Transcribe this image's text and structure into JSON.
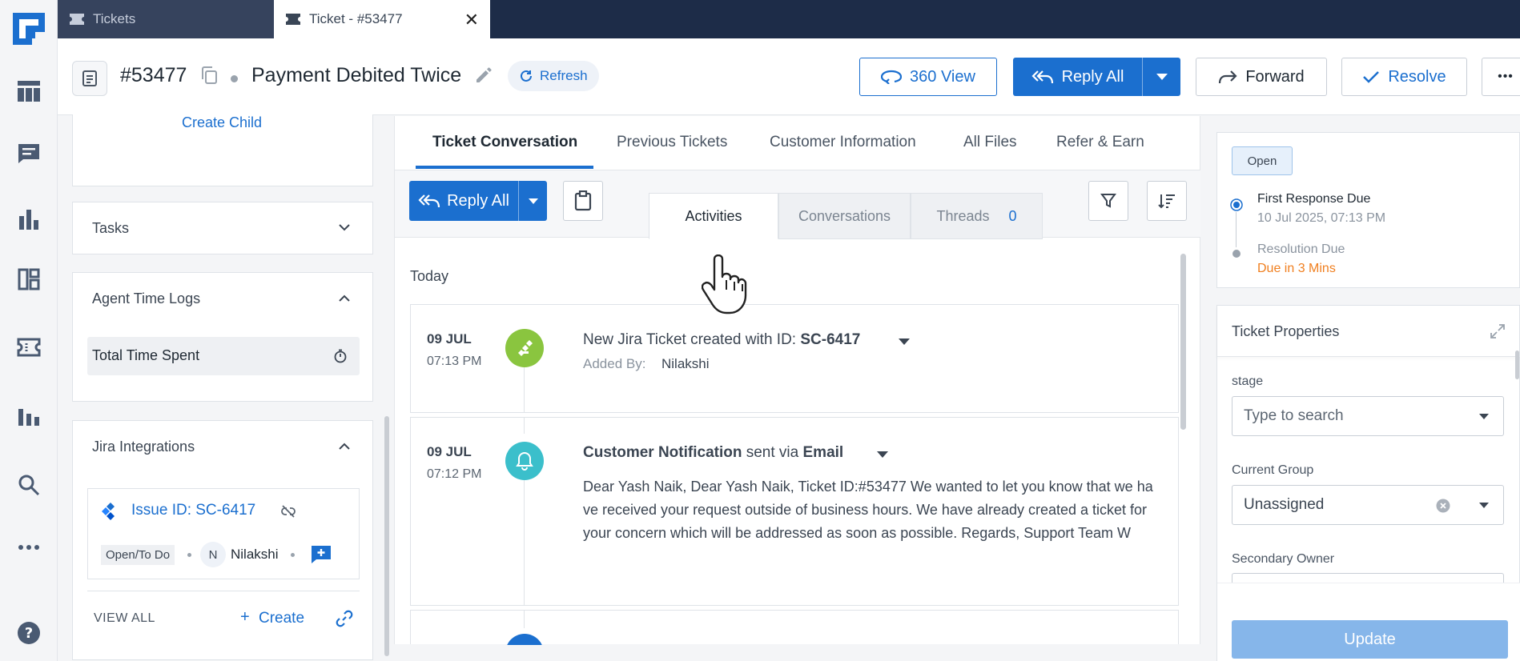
{
  "tabs": [
    {
      "label": "Tickets"
    },
    {
      "label": "Ticket - #53477"
    }
  ],
  "header": {
    "ticket_id": "#53477",
    "title": "Payment Debited Twice",
    "refresh_label": "Refresh",
    "view360_label": "360 View",
    "reply_all_label": "Reply All",
    "forward_label": "Forward",
    "resolve_label": "Resolve",
    "more_label": "•••"
  },
  "left": {
    "create_child": "Create Child",
    "tasks_title": "Tasks",
    "time_logs_title": "Agent Time Logs",
    "total_time_label": "Total Time Spent",
    "jira_title": "Jira Integrations",
    "jira_issue": "Issue ID: SC-6417",
    "jira_status": "Open/To Do",
    "jira_avatar": "N",
    "jira_assignee": "Nilakshi",
    "view_all": "VIEW ALL",
    "create_label": "Create",
    "create_plus": "+"
  },
  "center": {
    "tabs": [
      "Ticket Conversation",
      "Previous Tickets",
      "Customer Information",
      "All Files",
      "Refer & Earn"
    ],
    "reply_all_label": "Reply All",
    "subtabs": [
      "Activities",
      "Conversations",
      "Threads"
    ],
    "threads_count": "0",
    "today_label": "Today",
    "activities": [
      {
        "date": "09 JUL",
        "time": "07:13 PM",
        "text": "New Jira Ticket created with ID: ",
        "bold": "SC-6417",
        "added_by_label": "Added By:",
        "added_by": "Nilakshi"
      },
      {
        "date": "09 JUL",
        "time": "07:12 PM",
        "title": "Customer Notification",
        "via": " sent via ",
        "channel": "Email",
        "body": "Dear Yash Naik, Dear Yash Naik, Ticket ID:#53477 We wanted to let you know that we have received your request outside of business hours. We have already created a ticket for your concern which will be addressed as soon as possible. Regards, Support Team W"
      }
    ]
  },
  "right": {
    "status": "Open",
    "first_response_label": "First Response Due",
    "first_response_date": "10 Jul 2025, 07:13 PM",
    "resolution_label": "Resolution Due",
    "resolution_value": "Due in 3 Mins",
    "props_title": "Ticket Properties",
    "stage_label": "stage",
    "stage_placeholder": "Type to search",
    "group_label": "Current Group",
    "group_value": "Unassigned",
    "secondary_owner_label": "Secondary Owner",
    "update_label": "Update"
  },
  "colors": {
    "primary": "#1b6fcf",
    "nav_dark": "#1d2c48",
    "jira_green": "#8ac53f",
    "bell_teal": "#3bbfcb",
    "due_orange": "#f07f1f"
  }
}
